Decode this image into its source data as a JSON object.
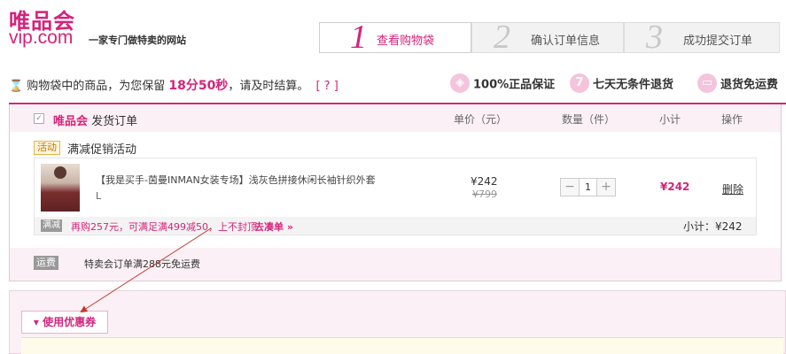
{
  "brand": {
    "logo_cn": "唯品会",
    "logo_en": "vip.com",
    "slogan": "一家专门做特卖的网站"
  },
  "steps": [
    {
      "num": "1",
      "label": "查看购物袋"
    },
    {
      "num": "2",
      "label": "确认订单信息"
    },
    {
      "num": "3",
      "label": "成功提交订单"
    }
  ],
  "timer": {
    "prefix": "购物袋中的商品，为您保留",
    "time": "18分50秒",
    "suffix": "，请及时结算。",
    "help": "[ ? ]"
  },
  "guarantees": [
    {
      "icon": "shield-icon",
      "glyph": "◈",
      "label": "100%正品保证"
    },
    {
      "icon": "seven-day-icon",
      "glyph": "7",
      "label": "七天无条件退货"
    },
    {
      "icon": "return-shipping-icon",
      "glyph": "▭",
      "label": "退货免运费"
    }
  ],
  "cart": {
    "shop_brand": "唯品会",
    "shop_suffix": " 发货订单",
    "columns": {
      "price": "单价（元）",
      "qty": "数量（件）",
      "subtotal": "小计",
      "action": "操作"
    },
    "promo_tag": "活动",
    "promo_name": "满减促销活动",
    "item": {
      "title": "【我是买手-茵曼INMAN女装专场】浅灰色拼接休闲长袖针织外套",
      "size": "L",
      "price": "¥242",
      "orig_price": "¥799",
      "qty": "1",
      "subtotal": "¥242",
      "delete": "删除"
    },
    "promo_row": {
      "tag": "满减",
      "text": "再购257元，可满足满499减50，上不封顶",
      "link": "去凑单 »",
      "subtotal": "小计：¥242"
    },
    "shipping": {
      "tag": "运费",
      "text": "特卖会订单满288元免运费"
    }
  },
  "coupon": {
    "label": "▾ 使用优惠券"
  },
  "colors": {
    "accent": "#d4237a"
  }
}
